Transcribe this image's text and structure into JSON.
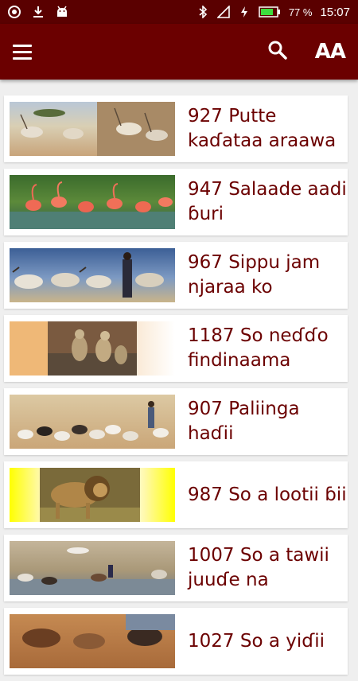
{
  "status_bar": {
    "battery": "77 %",
    "time": "15:07",
    "icons": [
      "app-logo-icon",
      "download-icon",
      "android-icon",
      "bluetooth-icon",
      "signal-icon",
      "charging-icon",
      "battery-icon"
    ]
  },
  "toolbar": {
    "menu_icon": "hamburger-menu-icon",
    "search_icon": "search-icon",
    "text_size_label": "AA"
  },
  "colors": {
    "status_bar": "#5a0000",
    "app_bar": "#6b0000",
    "title_text": "#6b0000",
    "background": "#efefef",
    "card": "#ffffff"
  },
  "items": [
    {
      "title": "927 Putte kaɗataa araawa",
      "image": "antelopes"
    },
    {
      "title": "947 Salaade aadi ɓuri",
      "image": "flamingos"
    },
    {
      "title": "967 Sippu jam njaraa ko",
      "image": "cattle-herder"
    },
    {
      "title": "1187 So neɗɗo findinaama",
      "image": "monkeys"
    },
    {
      "title": "907 Paliinga haɗii",
      "image": "sheep-herd"
    },
    {
      "title": "987 So a lootii ɓii",
      "image": "lion"
    },
    {
      "title": "1007 So a tawii juuɗe na",
      "image": "watering-hole"
    },
    {
      "title": "1027 So a yiɗii",
      "image": "animals"
    }
  ]
}
